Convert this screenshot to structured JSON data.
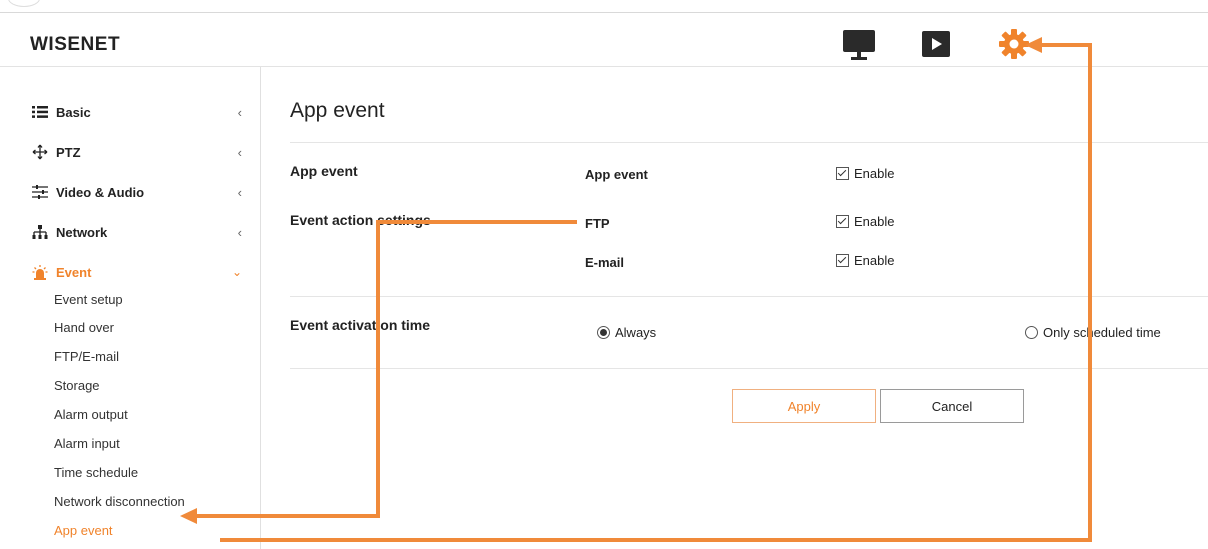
{
  "header": {
    "logo": "WISENET",
    "icons": [
      "monitor-icon",
      "play-icon",
      "gear-icon"
    ]
  },
  "sidebar": {
    "items": [
      {
        "label": "Basic",
        "icon": "list-icon",
        "chevron": "‹"
      },
      {
        "label": "PTZ",
        "icon": "move-icon",
        "chevron": "‹"
      },
      {
        "label": "Video & Audio",
        "icon": "sliders-icon",
        "chevron": "‹"
      },
      {
        "label": "Network",
        "icon": "network-icon",
        "chevron": "‹"
      },
      {
        "label": "Event",
        "icon": "alarm-icon",
        "chevron": "⌄"
      }
    ],
    "sub_items": [
      "Event setup",
      "Hand over",
      "FTP/E-mail",
      "Storage",
      "Alarm output",
      "Alarm input",
      "Time schedule",
      "Network disconnection",
      "App event"
    ]
  },
  "main": {
    "title": "App event",
    "app_event_section": "App event",
    "app_event_row": "App event",
    "event_action_section": "Event action settings",
    "ftp_row": "FTP",
    "email_row": "E-mail",
    "enable_label": "Enable",
    "activation_section": "Event activation time",
    "always_label": "Always",
    "scheduled_label": "Only scheduled time",
    "apply_label": "Apply",
    "cancel_label": "Cancel"
  },
  "colors": {
    "accent": "#f0832b",
    "annotation": "#f08a3a"
  }
}
